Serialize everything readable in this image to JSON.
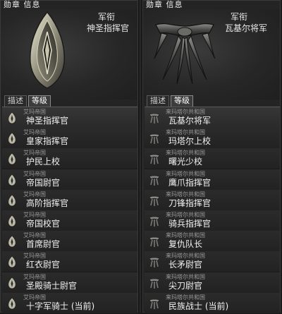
{
  "left_panel": {
    "title": "勋章 信息",
    "rank_heading": "军衔",
    "rank_name": "神圣指挥官",
    "emblem_icon": "shield-emblem-icon",
    "tabs": [
      {
        "label": "描述",
        "active": false
      },
      {
        "label": "等级",
        "active": true
      }
    ],
    "rows": [
      {
        "faction": "艾玛帝国",
        "name": "神圣指挥官",
        "icon": "rank-badge-icon"
      },
      {
        "faction": "艾玛帝国",
        "name": "皇家指挥官",
        "icon": "rank-badge-icon"
      },
      {
        "faction": "艾玛帝国",
        "name": "护民上校",
        "icon": "rank-badge-icon"
      },
      {
        "faction": "艾玛帝国",
        "name": "帝国尉官",
        "icon": "rank-badge-icon"
      },
      {
        "faction": "艾玛帝国",
        "name": "高阶指挥官",
        "icon": "rank-badge-icon"
      },
      {
        "faction": "艾玛帝国",
        "name": "帝国校官",
        "icon": "rank-badge-icon"
      },
      {
        "faction": "艾玛帝国",
        "name": "首席尉官",
        "icon": "rank-badge-icon"
      },
      {
        "faction": "艾玛帝国",
        "name": "红衣尉官",
        "icon": "rank-badge-icon"
      },
      {
        "faction": "艾玛帝国",
        "name": "圣殿骑士尉官",
        "icon": "rank-badge-icon"
      },
      {
        "faction": "艾玛帝国",
        "name": "十字军骑士 (当前)",
        "icon": "rank-badge-icon"
      }
    ]
  },
  "right_panel": {
    "title": "勋章 信息",
    "rank_heading": "军衔",
    "rank_name": "瓦基尔将军",
    "emblem_icon": "claw-emblem-icon",
    "tabs": [
      {
        "label": "描述",
        "active": false
      },
      {
        "label": "等级",
        "active": true
      }
    ],
    "rows": [
      {
        "faction": "来玛塔尔共和国",
        "name": "瓦基尔将军",
        "icon": "claw-badge-icon"
      },
      {
        "faction": "来玛塔尔共和国",
        "name": "玛塔尔上校",
        "icon": "claw-badge-icon"
      },
      {
        "faction": "来玛塔尔共和国",
        "name": "曙光少校",
        "icon": "claw-badge-icon"
      },
      {
        "faction": "来玛塔尔共和国",
        "name": "鹰爪指挥官",
        "icon": "claw-badge-icon"
      },
      {
        "faction": "来玛塔尔共和国",
        "name": "刀锋指挥官",
        "icon": "claw-badge-icon"
      },
      {
        "faction": "来玛塔尔共和国",
        "name": "骑兵指挥官",
        "icon": "claw-badge-icon"
      },
      {
        "faction": "来玛塔尔共和国",
        "name": "复仇队长",
        "icon": "claw-badge-icon"
      },
      {
        "faction": "来玛塔尔共和国",
        "name": "长矛尉官",
        "icon": "claw-badge-icon"
      },
      {
        "faction": "来玛塔尔共和国",
        "name": "尖刀尉官",
        "icon": "claw-badge-icon"
      },
      {
        "faction": "来玛塔尔共和国",
        "name": "民族战士 (当前)",
        "icon": "claw-badge-icon"
      }
    ]
  }
}
